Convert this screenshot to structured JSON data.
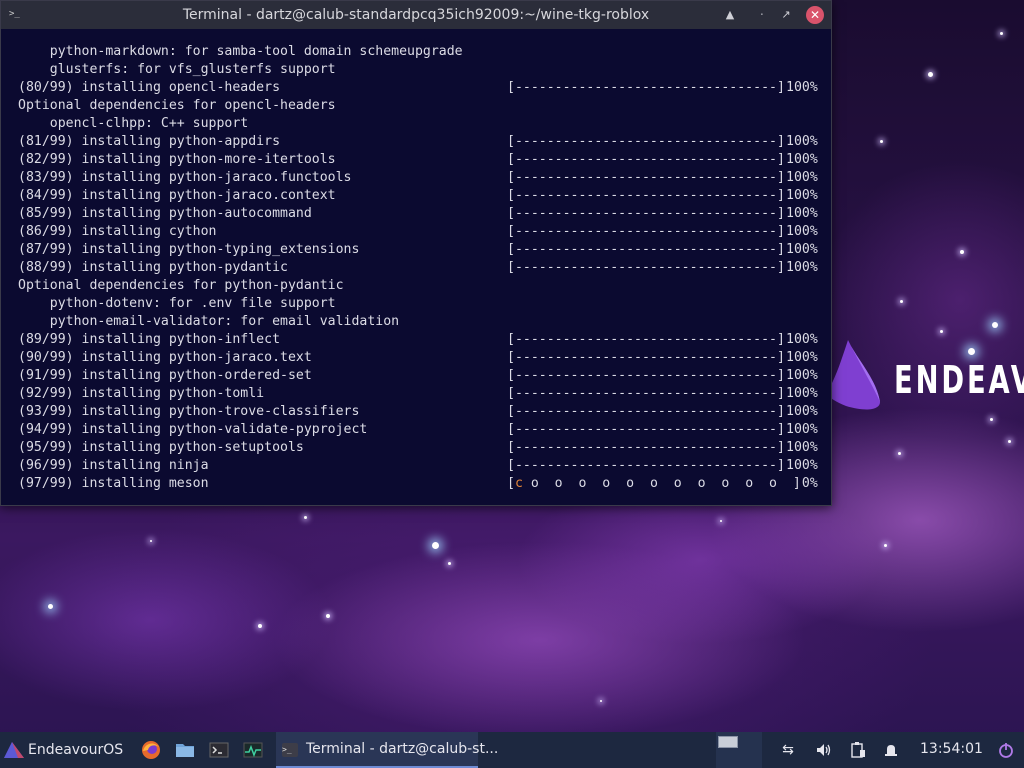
{
  "window": {
    "title": "Terminal - dartz@calub-standardpcq35ich92009:~/wine-tkg-roblox",
    "icon": "terminal-icon",
    "buttons": [
      "keep-above-icon",
      "minimize-icon",
      "maximize-icon",
      "close-icon"
    ]
  },
  "terminal": {
    "lines": [
      {
        "text": "    python-markdown: for samba-tool domain schemeupgrade"
      },
      {
        "text": "    glusterfs: for vfs_glusterfs support"
      },
      {
        "text": "(80/99) installing opencl-headers",
        "bar": "[---------------------------------]",
        "pct": "100%"
      },
      {
        "text": "Optional dependencies for opencl-headers"
      },
      {
        "text": "    opencl-clhpp: C++ support"
      },
      {
        "text": "(81/99) installing python-appdirs",
        "bar": "[---------------------------------]",
        "pct": "100%"
      },
      {
        "text": "(82/99) installing python-more-itertools",
        "bar": "[---------------------------------]",
        "pct": "100%"
      },
      {
        "text": "(83/99) installing python-jaraco.functools",
        "bar": "[---------------------------------]",
        "pct": "100%"
      },
      {
        "text": "(84/99) installing python-jaraco.context",
        "bar": "[---------------------------------]",
        "pct": "100%"
      },
      {
        "text": "(85/99) installing python-autocommand",
        "bar": "[---------------------------------]",
        "pct": "100%"
      },
      {
        "text": "(86/99) installing cython",
        "bar": "[---------------------------------]",
        "pct": "100%"
      },
      {
        "text": "(87/99) installing python-typing_extensions",
        "bar": "[---------------------------------]",
        "pct": "100%"
      },
      {
        "text": "(88/99) installing python-pydantic",
        "bar": "[---------------------------------]",
        "pct": "100%"
      },
      {
        "text": "Optional dependencies for python-pydantic"
      },
      {
        "text": "    python-dotenv: for .env file support"
      },
      {
        "text": "    python-email-validator: for email validation"
      },
      {
        "text": "(89/99) installing python-inflect",
        "bar": "[---------------------------------]",
        "pct": "100%"
      },
      {
        "text": "(90/99) installing python-jaraco.text",
        "bar": "[---------------------------------]",
        "pct": "100%"
      },
      {
        "text": "(91/99) installing python-ordered-set",
        "bar": "[---------------------------------]",
        "pct": "100%"
      },
      {
        "text": "(92/99) installing python-tomli",
        "bar": "[---------------------------------]",
        "pct": "100%"
      },
      {
        "text": "(93/99) installing python-trove-classifiers",
        "bar": "[---------------------------------]",
        "pct": "100%"
      },
      {
        "text": "(94/99) installing python-validate-pyproject",
        "bar": "[---------------------------------]",
        "pct": "100%"
      },
      {
        "text": "(95/99) installing python-setuptools",
        "bar": "[---------------------------------]",
        "pct": "100%"
      },
      {
        "text": "(96/99) installing ninja",
        "bar": "[---------------------------------]",
        "pct": "100%"
      },
      {
        "text": "(97/99) installing meson",
        "bar_prefix": "[",
        "bar_pacman": "c",
        "bar_rest": " o  o  o  o  o  o  o  o  o  o  o  ]",
        "pct": "0%"
      }
    ]
  },
  "desktop": {
    "logo_text": "ENDEAVOUR"
  },
  "taskbar": {
    "start_label": "EndeavourOS",
    "launchers": [
      "firefox-icon",
      "file-manager-icon",
      "terminal-icon",
      "system-monitor-icon"
    ],
    "task_label": "Terminal - dartz@calub-st...",
    "tray_icons": [
      "network-icon",
      "volume-icon",
      "clipboard-icon",
      "notifications-icon"
    ],
    "clock": "13:54:01"
  },
  "colors": {
    "terminal_bg": "#0b0a30",
    "terminal_text": "#dcdce6",
    "titlebar": "#2b2d3a",
    "taskbar": "#1d2840",
    "close_button": "#d9536b",
    "pacman": "#e0843a"
  }
}
